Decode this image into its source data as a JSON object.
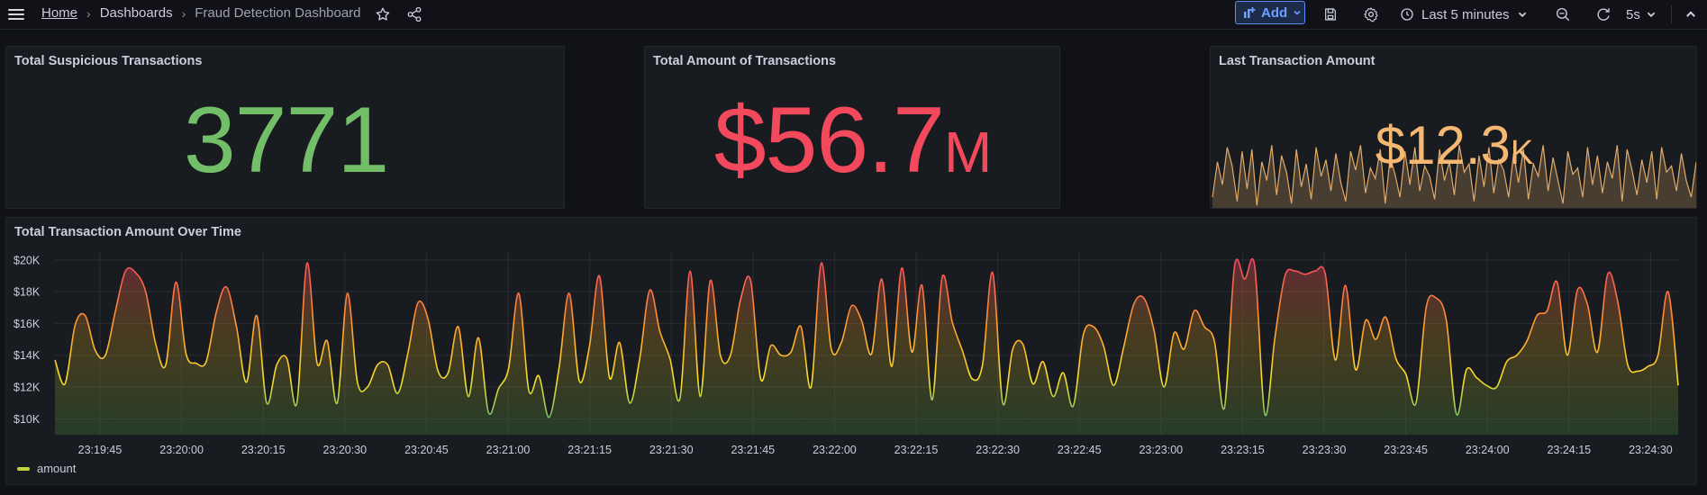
{
  "topbar": {
    "breadcrumb": {
      "home": "Home",
      "dashboards": "Dashboards",
      "current": "Fraud Detection Dashboard",
      "separator": "›"
    },
    "add_label": "Add",
    "time_range": "Last 5 minutes",
    "refresh_interval": "5s"
  },
  "panels": {
    "suspicious": {
      "title": "Total Suspicious Transactions",
      "value": "3771",
      "color": "#73bf69"
    },
    "amount": {
      "title": "Total Amount of Transactions",
      "value": "$56.7",
      "unit": "M",
      "color": "#f2495c"
    },
    "last": {
      "title": "Last Transaction Amount",
      "value": "$12.3",
      "unit": "K",
      "color": "#f5b872"
    },
    "timeseries": {
      "title": "Total Transaction Amount Over Time"
    }
  },
  "chart_data": [
    {
      "type": "area",
      "title": "Last Transaction Amount",
      "color": "#f5b872",
      "values": [
        10.6,
        12.3,
        11.2,
        13.0,
        12.1,
        10.4,
        12.8,
        11.0,
        12.9,
        10.2,
        12.3,
        11.4,
        13.1,
        10.7,
        12.6,
        11.8,
        10.3,
        12.9,
        11.1,
        12.2,
        10.5,
        13.0,
        11.6,
        12.4,
        10.9,
        12.7,
        11.3,
        10.4,
        12.8,
        11.9,
        13.1,
        10.8,
        12.0,
        11.5,
        12.9,
        10.3,
        12.5,
        11.7,
        10.6,
        12.8,
        11.2,
        13.0,
        10.9,
        12.1,
        11.6,
        10.5,
        12.9,
        11.4,
        12.3,
        10.7,
        13.1,
        11.8,
        12.2,
        10.4,
        12.6,
        11.1,
        13.0,
        10.8,
        12.4,
        11.9,
        10.6,
        12.7,
        11.3,
        12.9,
        10.5,
        12.2,
        11.6,
        13.1,
        10.9,
        12.5,
        11.4,
        10.3,
        12.8,
        11.7,
        12.0,
        10.6,
        13.0,
        11.2,
        12.6,
        10.8,
        12.3,
        11.5,
        13.1,
        10.4,
        12.9,
        11.9,
        10.7,
        12.4,
        11.3,
        12.8,
        10.5,
        13.0,
        11.8,
        12.1,
        10.9,
        12.7,
        11.4,
        10.6,
        12.3
      ],
      "ylim": [
        10,
        13.5
      ]
    },
    {
      "type": "line",
      "title": "Total Transaction Amount Over Time",
      "series": [
        {
          "name": "amount",
          "values": [
            13.7,
            12.2,
            15.9,
            16.5,
            14.3,
            14.0,
            16.8,
            19.3,
            19.2,
            18.0,
            14.7,
            13.4,
            18.6,
            14.1,
            13.5,
            13.6,
            16.7,
            18.3,
            15.8,
            12.3,
            16.5,
            11.0,
            13.4,
            13.8,
            11.0,
            19.8,
            13.5,
            14.9,
            11.0,
            17.9,
            12.3,
            12.0,
            13.4,
            13.4,
            11.6,
            14.1,
            17.3,
            16.3,
            13.0,
            12.9,
            15.8,
            11.4,
            15.1,
            10.4,
            11.9,
            13.2,
            17.9,
            11.8,
            12.7,
            10.1,
            13.2,
            17.9,
            12.4,
            14.5,
            19.0,
            12.6,
            14.8,
            11.0,
            13.8,
            18.1,
            15.5,
            13.8,
            11.3,
            19.3,
            11.4,
            18.7,
            14.0,
            14.0,
            17.5,
            18.7,
            12.5,
            14.6,
            14.0,
            14.2,
            15.8,
            12.0,
            19.8,
            14.4,
            14.8,
            17.1,
            16.2,
            14.1,
            18.8,
            13.3,
            19.5,
            14.2,
            18.4,
            11.2,
            18.9,
            16.1,
            14.3,
            12.5,
            13.4,
            19.2,
            11.0,
            14.4,
            14.7,
            12.2,
            13.6,
            11.4,
            12.9,
            10.8,
            15.3,
            15.8,
            14.6,
            12.1,
            14.5,
            17.2,
            17.6,
            15.6,
            12.0,
            15.4,
            14.4,
            16.8,
            15.8,
            14.9,
            10.7,
            19.6,
            18.8,
            19.6,
            10.3,
            15.1,
            19.0,
            19.3,
            19.1,
            19.3,
            19.1,
            13.7,
            18.4,
            13.1,
            16.2,
            15.0,
            16.4,
            13.8,
            12.8,
            11.0,
            17.0,
            17.6,
            16.2,
            10.3,
            13.1,
            12.6,
            12.1,
            12.0,
            13.6,
            14.0,
            14.9,
            16.5,
            16.8,
            18.6,
            14.0,
            18.1,
            17.2,
            14.2,
            19.1,
            17.4,
            13.4,
            13.0,
            13.3,
            14.0,
            18.0,
            12.1
          ]
        }
      ],
      "x_ticks": [
        "23:19:45",
        "23:20:00",
        "23:20:15",
        "23:20:30",
        "23:20:45",
        "23:21:00",
        "23:21:15",
        "23:21:30",
        "23:21:45",
        "23:22:00",
        "23:22:15",
        "23:22:30",
        "23:22:45",
        "23:23:00",
        "23:23:15",
        "23:23:30",
        "23:23:45",
        "23:24:00",
        "23:24:15",
        "23:24:30"
      ],
      "y_ticks": [
        "$10K",
        "$12K",
        "$14K",
        "$16K",
        "$18K",
        "$20K"
      ],
      "ylim": [
        9,
        20.5
      ],
      "legend": "bottom-left"
    }
  ]
}
